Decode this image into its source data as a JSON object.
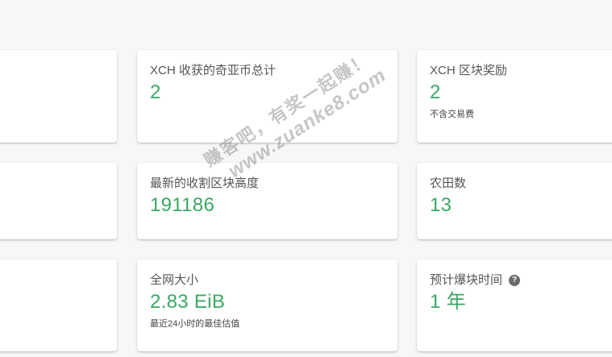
{
  "cards": {
    "farmed_total": {
      "title": "XCH 收获的奇亚币总计",
      "value": "2"
    },
    "block_rewards": {
      "title": "XCH 区块奖励",
      "value": "2",
      "note": "不含交易费"
    },
    "last_height": {
      "title": "最新的收割区块高度",
      "value": "191186"
    },
    "plot_count": {
      "title": "农田数",
      "value": "13"
    },
    "netspace": {
      "title": "全网大小",
      "value": "2.83 EiB",
      "note": "最近24小时的最佳估值"
    },
    "time_to_win": {
      "title": "预计爆块时间",
      "value": "1 年",
      "help_icon": "help-circle-icon"
    }
  },
  "watermark": {
    "line1": "赚客吧，有奖一起赚！",
    "line2": "www.zuanke8.com"
  },
  "colors": {
    "accent": "#3aa864",
    "background": "#f7f7f7",
    "card": "#ffffff"
  }
}
